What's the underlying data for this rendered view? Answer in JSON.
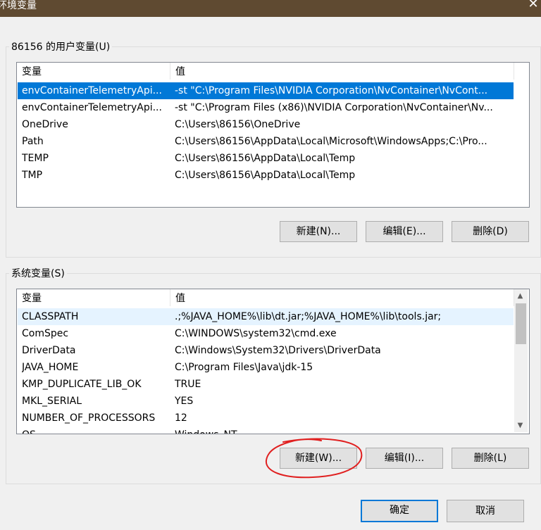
{
  "window": {
    "title": "环境变量",
    "close_icon": "close-icon"
  },
  "user_vars": {
    "group_label": "86156 的用户变量(U)",
    "headers": [
      "变量",
      "值"
    ],
    "rows": [
      {
        "name": "envContainerTelemetryApi...",
        "value": "-st \"C:\\Program Files\\NVIDIA Corporation\\NvContainer\\NvCont..."
      },
      {
        "name": "envContainerTelemetryApi...",
        "value": "-st \"C:\\Program Files (x86)\\NVIDIA Corporation\\NvContainer\\Nv..."
      },
      {
        "name": "OneDrive",
        "value": "C:\\Users\\86156\\OneDrive"
      },
      {
        "name": "Path",
        "value": "C:\\Users\\86156\\AppData\\Local\\Microsoft\\WindowsApps;C:\\Pro..."
      },
      {
        "name": "TEMP",
        "value": "C:\\Users\\86156\\AppData\\Local\\Temp"
      },
      {
        "name": "TMP",
        "value": "C:\\Users\\86156\\AppData\\Local\\Temp"
      }
    ],
    "buttons": {
      "new": "新建(N)...",
      "edit": "编辑(E)...",
      "delete": "删除(D)"
    }
  },
  "system_vars": {
    "group_label": "系统变量(S)",
    "headers": [
      "变量",
      "值"
    ],
    "rows": [
      {
        "name": "CLASSPATH",
        "value": ".;%JAVA_HOME%\\lib\\dt.jar;%JAVA_HOME%\\lib\\tools.jar;"
      },
      {
        "name": "ComSpec",
        "value": "C:\\WINDOWS\\system32\\cmd.exe"
      },
      {
        "name": "DriverData",
        "value": "C:\\Windows\\System32\\Drivers\\DriverData"
      },
      {
        "name": "JAVA_HOME",
        "value": "C:\\Program Files\\Java\\jdk-15"
      },
      {
        "name": "KMP_DUPLICATE_LIB_OK",
        "value": "TRUE"
      },
      {
        "name": "MKL_SERIAL",
        "value": "YES"
      },
      {
        "name": "NUMBER_OF_PROCESSORS",
        "value": "12"
      },
      {
        "name": "OS",
        "value": "Windows_NT"
      }
    ],
    "buttons": {
      "new": "新建(W)...",
      "edit": "编辑(I)...",
      "delete": "删除(L)"
    }
  },
  "footer": {
    "ok": "确定",
    "cancel": "取消"
  },
  "colors": {
    "selection": "#0078d7",
    "hover_row": "#e5f3ff",
    "annotation": "#e02020",
    "titlebar": "#5f4a31"
  }
}
